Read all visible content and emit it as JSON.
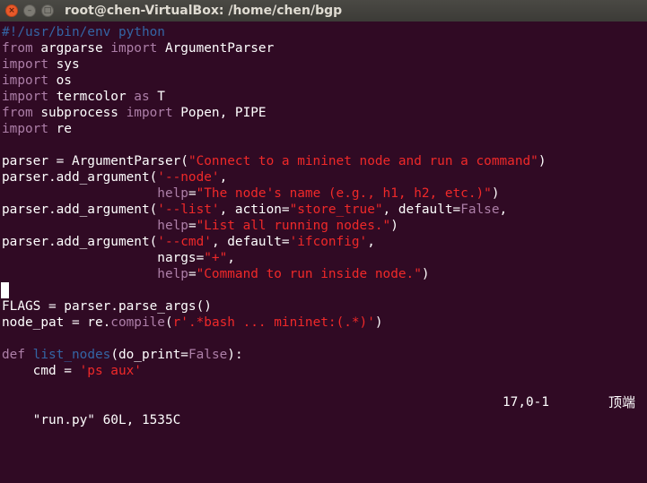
{
  "window": {
    "title": "root@chen-VirtualBox: /home/chen/bgp",
    "buttons": {
      "close": "×",
      "minimize": "–",
      "maximize": "□"
    }
  },
  "colors": {
    "background": "#300a24",
    "text": "#ffffff",
    "comment": "#3465a4",
    "keyword": "#ad7fa8",
    "string": "#ef2929",
    "highlight": "#ad7fa8"
  },
  "editor": {
    "lines": [
      [
        [
          "c",
          "#!/usr/bin/env python"
        ]
      ],
      [
        [
          "kw",
          "from"
        ],
        [
          "t",
          " argparse "
        ],
        [
          "kw",
          "import"
        ],
        [
          "t",
          " ArgumentParser"
        ]
      ],
      [
        [
          "kw",
          "import"
        ],
        [
          "t",
          " sys"
        ]
      ],
      [
        [
          "kw",
          "import"
        ],
        [
          "t",
          " os"
        ]
      ],
      [
        [
          "kw",
          "import"
        ],
        [
          "t",
          " termcolor "
        ],
        [
          "kw",
          "as"
        ],
        [
          "t",
          " T"
        ]
      ],
      [
        [
          "kw",
          "from"
        ],
        [
          "t",
          " subprocess "
        ],
        [
          "kw",
          "import"
        ],
        [
          "t",
          " Popen, PIPE"
        ]
      ],
      [
        [
          "kw",
          "import"
        ],
        [
          "t",
          " re"
        ]
      ],
      [],
      [
        [
          "t",
          "parser = ArgumentParser("
        ],
        [
          "s",
          "\"Connect to a mininet node and run a command\""
        ],
        [
          "t",
          ")"
        ]
      ],
      [
        [
          "t",
          "parser.add_argument("
        ],
        [
          "s",
          "'--node'"
        ],
        [
          "t",
          ","
        ]
      ],
      [
        [
          "t",
          "                    "
        ],
        [
          "h",
          "help"
        ],
        [
          "t",
          "="
        ],
        [
          "s",
          "\"The node's name (e.g., h1, h2, etc.)\""
        ],
        [
          "t",
          ")"
        ]
      ],
      [
        [
          "t",
          "parser.add_argument("
        ],
        [
          "s",
          "'--list'"
        ],
        [
          "t",
          ", action="
        ],
        [
          "s",
          "\"store_true\""
        ],
        [
          "t",
          ", default="
        ],
        [
          "h",
          "False"
        ],
        [
          "t",
          ","
        ]
      ],
      [
        [
          "t",
          "                    "
        ],
        [
          "h",
          "help"
        ],
        [
          "t",
          "="
        ],
        [
          "s",
          "\"List all running nodes.\""
        ],
        [
          "t",
          ")"
        ]
      ],
      [
        [
          "t",
          "parser.add_argument("
        ],
        [
          "s",
          "'--cmd'"
        ],
        [
          "t",
          ", default="
        ],
        [
          "s",
          "'ifconfig'"
        ],
        [
          "t",
          ","
        ]
      ],
      [
        [
          "t",
          "                    nargs="
        ],
        [
          "s",
          "\"+\""
        ],
        [
          "t",
          ","
        ]
      ],
      [
        [
          "t",
          "                    "
        ],
        [
          "h",
          "help"
        ],
        [
          "t",
          "="
        ],
        [
          "s",
          "\"Command to run inside node.\""
        ],
        [
          "t",
          ")"
        ]
      ],
      [],
      [
        [
          "t",
          "FLAGS = parser.parse_args()"
        ]
      ],
      [
        [
          "t",
          "node_pat = re."
        ],
        [
          "h",
          "compile"
        ],
        [
          "t",
          "("
        ],
        [
          "s",
          "r'.*bash ... mininet:(.*)'"
        ],
        [
          "t",
          ")"
        ]
      ],
      [],
      [
        [
          "kw",
          "def"
        ],
        [
          "t",
          " "
        ],
        [
          "c",
          "list_nodes"
        ],
        [
          "t",
          "(do_print="
        ],
        [
          "h",
          "False"
        ],
        [
          "t",
          "):"
        ]
      ],
      [
        [
          "t",
          "    cmd = "
        ],
        [
          "s",
          "'ps aux'"
        ]
      ]
    ]
  },
  "status": {
    "file": "\"run.py\" 60L, 1535C",
    "position": "17,0-1",
    "percent": "顶端"
  }
}
